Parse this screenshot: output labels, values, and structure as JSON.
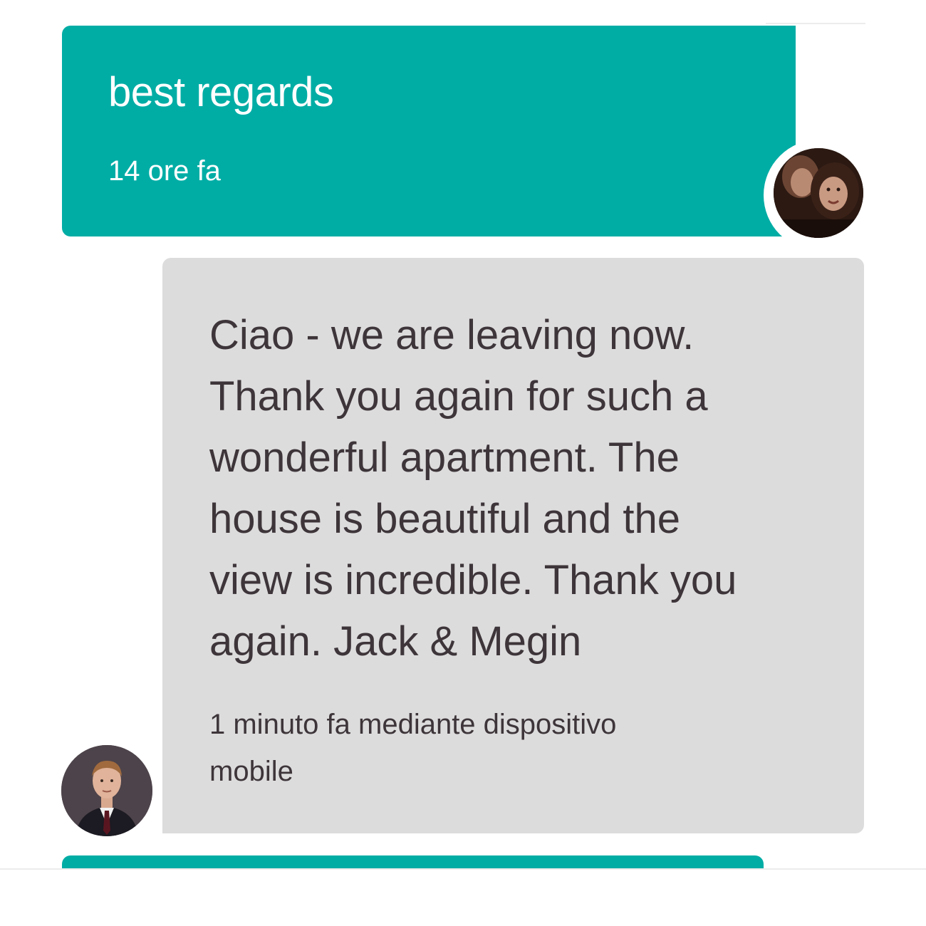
{
  "colors": {
    "sent_bubble": "#00ada5",
    "received_bubble": "#dddcdd",
    "received_text": "#3d3539",
    "sent_text": "#ffffff"
  },
  "messages": [
    {
      "sender": "guest",
      "text": "best regards",
      "time": "14 ore fa",
      "avatar_icon": "guest-avatar-photo"
    },
    {
      "sender": "host",
      "lines": [
        "Ciao - we are leaving now.",
        "Thank you again for such a",
        "wonderful apartment. The",
        "house is beautiful and the",
        "view is incredible. Thank you",
        "again. Jack & Megin"
      ],
      "time_lines": [
        "1 minuto fa mediante dispositivo",
        "mobile"
      ],
      "avatar_icon": "host-avatar-photo"
    }
  ]
}
